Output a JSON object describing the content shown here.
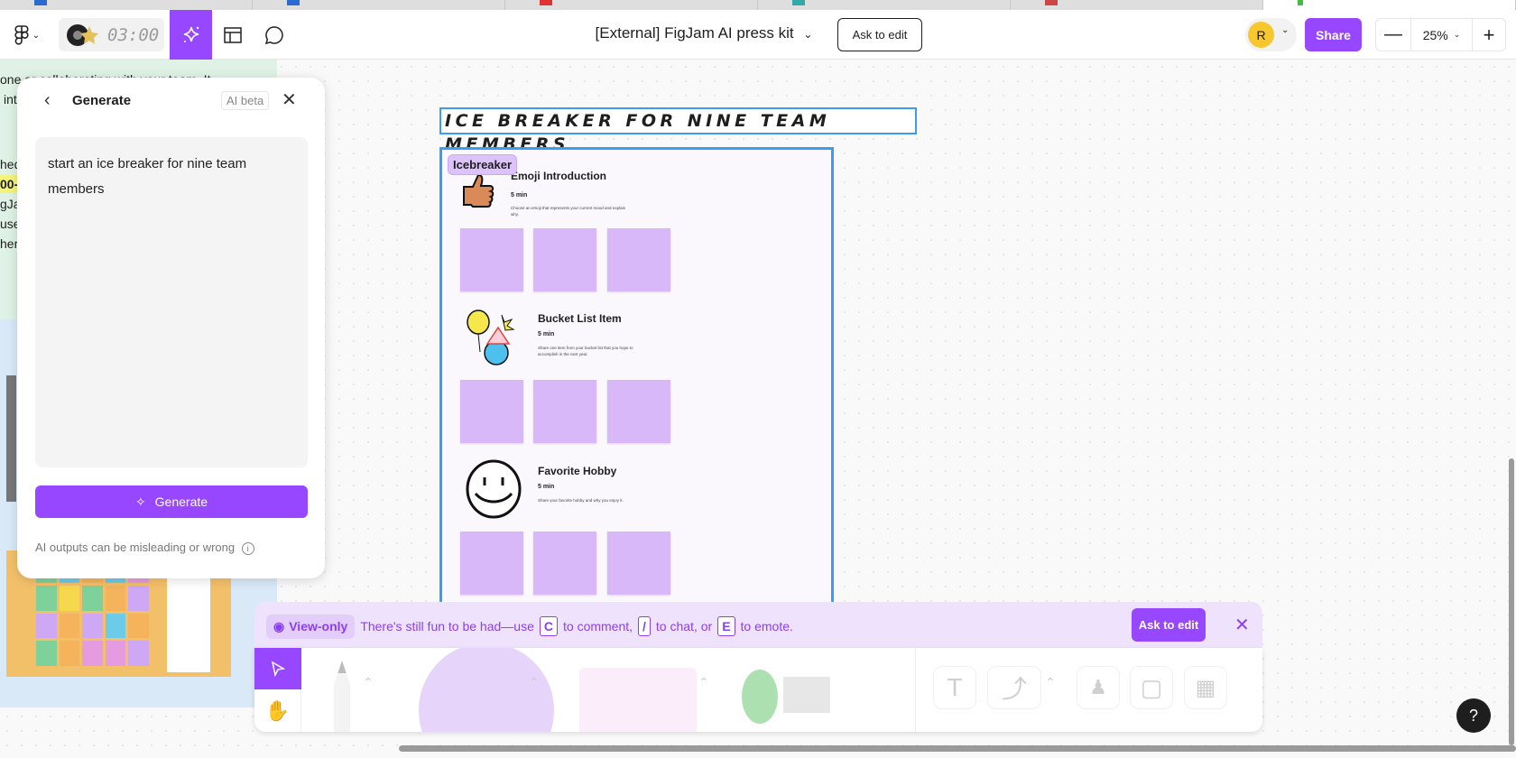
{
  "topbar": {
    "timer": "03:00",
    "doc_title": "[External] FigJam AI press kit",
    "ask_to_edit": "Ask to edit",
    "avatar_initial": "R",
    "share": "Share",
    "zoom": "25%",
    "icons": [
      "figma-logo-icon",
      "sparkle-icon",
      "layout-icon",
      "chat-icon",
      "minus-icon",
      "plus-icon"
    ]
  },
  "background_doc": {
    "lines": [
      "one or collaborating with your team. It",
      "int",
      "",
      "",
      "hed",
      "00-",
      "gJa",
      "use",
      "her"
    ]
  },
  "generate_panel": {
    "title": "Generate",
    "badge": "AI beta",
    "prompt": "start an ice breaker for nine team members",
    "button": "Generate",
    "disclaimer": "AI outputs can be misleading or wrong"
  },
  "board": {
    "title": "ICE BREAKER FOR NINE TEAM MEMBERS",
    "section_label": "Icebreaker",
    "activities": [
      {
        "title": "Emoji Introduction",
        "duration": "5 min",
        "description": "Choose an emoji that represents your current mood and explain why."
      },
      {
        "title": "Bucket List Item",
        "duration": "5 min",
        "description": "Share one item from your bucket list that you hope to accomplish in the next year."
      },
      {
        "title": "Favorite Hobby",
        "duration": "5 min",
        "description": "Share your favorite hobby and why you enjoy it."
      }
    ]
  },
  "banner": {
    "mode": "View-only",
    "text1": "There's still fun to be had—use",
    "key_c": "C",
    "text2": "to comment,",
    "key_slash": "/",
    "text3": "to chat, or",
    "key_e": "E",
    "text4": "to emote.",
    "ask_to_edit": "Ask to edit"
  },
  "help": "?",
  "colors": {
    "accent": "#9747ff",
    "frame_border": "#3a9ef0",
    "sticky": "#d9b8fa"
  }
}
